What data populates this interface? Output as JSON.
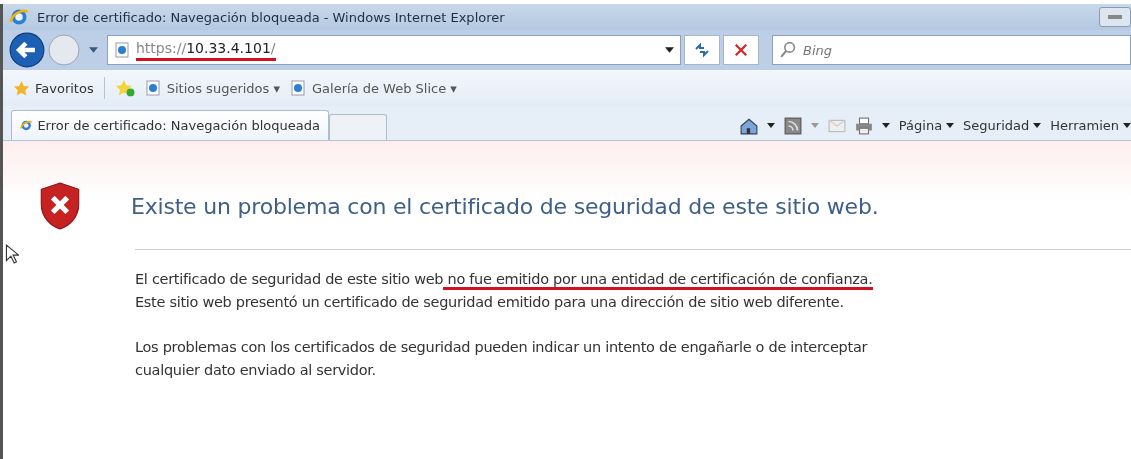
{
  "window": {
    "title": "Error de certificado: Navegación bloqueada - Windows Internet Explorer"
  },
  "address_bar": {
    "scheme": "https://",
    "host": "10.33.4.101",
    "trail": "/",
    "underlined": true
  },
  "search": {
    "placeholder": "Bing"
  },
  "favorites_bar": {
    "favorites": "Favoritos",
    "items": [
      {
        "label": "Sitios sugeridos ▾"
      },
      {
        "label": "Galería de Web Slice ▾"
      }
    ]
  },
  "tabs": [
    {
      "label": "Error de certificado: Navegación bloqueada",
      "selected": true
    },
    {
      "selected": false
    }
  ],
  "command_bar": [
    {
      "kind": "home"
    },
    {
      "kind": "feed"
    },
    {
      "kind": "mail"
    },
    {
      "kind": "print"
    },
    {
      "kind": "menu",
      "label": "Página"
    },
    {
      "kind": "menu",
      "label": "Seguridad"
    },
    {
      "kind": "menu",
      "label": "Herramien"
    }
  ],
  "page": {
    "heading": "Existe un problema con el certificado de seguridad de este sitio web.",
    "paragraphs": [
      [
        {
          "text": "El certificado de seguridad de este sitio web",
          "underlined": false
        },
        {
          "text": " no fue emitido por una entidad de certificación de confianza.",
          "underlined": true
        },
        {
          "text": "\nEste sitio web presentó un certificado de seguridad emitido para una dirección de sitio web diferente.",
          "underlined": false
        }
      ],
      [
        {
          "text": "Los problemas con los certificados de seguridad pueden indicar un intento de engañarle o de interceptar\ncualquier dato enviado al servidor.",
          "underlined": false
        }
      ]
    ]
  }
}
